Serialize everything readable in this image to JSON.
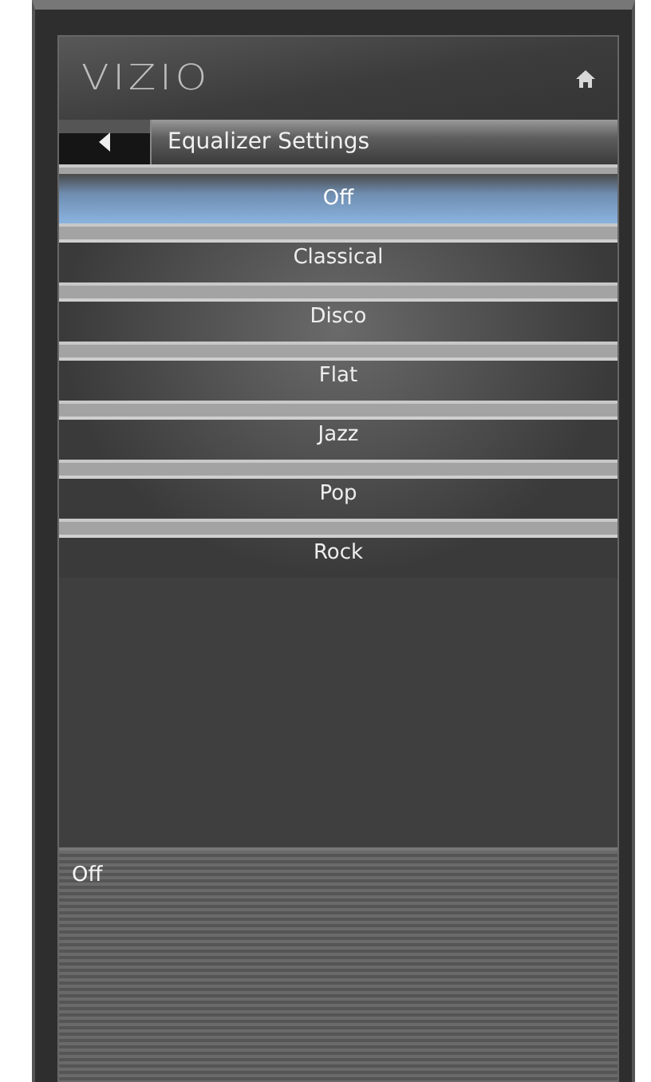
{
  "header": {
    "logo": "VIZIO"
  },
  "nav": {
    "title": "Equalizer Settings"
  },
  "options": [
    {
      "label": "Off",
      "selected": true
    },
    {
      "label": "Classical",
      "selected": false
    },
    {
      "label": "Disco",
      "selected": false
    },
    {
      "label": "Flat",
      "selected": false
    },
    {
      "label": "Jazz",
      "selected": false
    },
    {
      "label": "Pop",
      "selected": false
    },
    {
      "label": "Rock",
      "selected": false
    }
  ],
  "description": {
    "text": "Off"
  }
}
